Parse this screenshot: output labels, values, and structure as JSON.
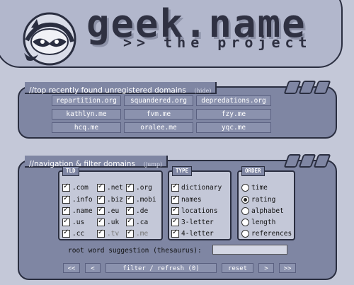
{
  "header": {
    "title": "geek.name",
    "subtitle": ">> the project",
    "logo_icon": "raccoon-icon"
  },
  "unregistered": {
    "title": "//top recently found unregistered domains",
    "hide_label": "(hide)",
    "domains": [
      "repartition.org",
      "squandered.org",
      "depredations.org",
      "kathlyn.me",
      "fvm.me",
      "fzy.me",
      "hcq.me",
      "oralee.me",
      "yqc.me"
    ]
  },
  "navigation": {
    "title": "//navigation & filter domains",
    "jump_label": "(jump)",
    "tld": {
      "legend": "TLD",
      "options": [
        {
          "label": ".com",
          "checked": true
        },
        {
          "label": ".net",
          "checked": true
        },
        {
          "label": ".org",
          "checked": true
        },
        {
          "label": ".info",
          "checked": true
        },
        {
          "label": ".biz",
          "checked": true
        },
        {
          "label": ".mobi",
          "checked": true
        },
        {
          "label": ".name",
          "checked": true
        },
        {
          "label": ".eu",
          "checked": true
        },
        {
          "label": ".de",
          "checked": true
        },
        {
          "label": ".us",
          "checked": true
        },
        {
          "label": ".uk",
          "checked": true
        },
        {
          "label": ".ca",
          "checked": true
        },
        {
          "label": ".cc",
          "checked": true
        },
        {
          "label": ".tv",
          "checked": true
        },
        {
          "label": ".me",
          "checked": true
        }
      ]
    },
    "type": {
      "legend": "TYPE",
      "options": [
        {
          "label": "dictionary",
          "checked": true
        },
        {
          "label": "names",
          "checked": true
        },
        {
          "label": "locations",
          "checked": true
        },
        {
          "label": "3-letter",
          "checked": true
        },
        {
          "label": "4-letter",
          "checked": true
        }
      ]
    },
    "order": {
      "legend": "ORDER",
      "options": [
        {
          "label": "time",
          "selected": false
        },
        {
          "label": "rating",
          "selected": true
        },
        {
          "label": "alphabet",
          "selected": false
        },
        {
          "label": "length",
          "selected": false
        },
        {
          "label": "references",
          "selected": false
        }
      ]
    },
    "suggestion_label": "root word suggestion (thesaurus):",
    "suggestion_value": "",
    "buttons": {
      "first": "<<",
      "prev": "<",
      "filter": "filter / refresh (0)",
      "reset": "reset",
      "next": ">",
      "last": ">>"
    }
  }
}
